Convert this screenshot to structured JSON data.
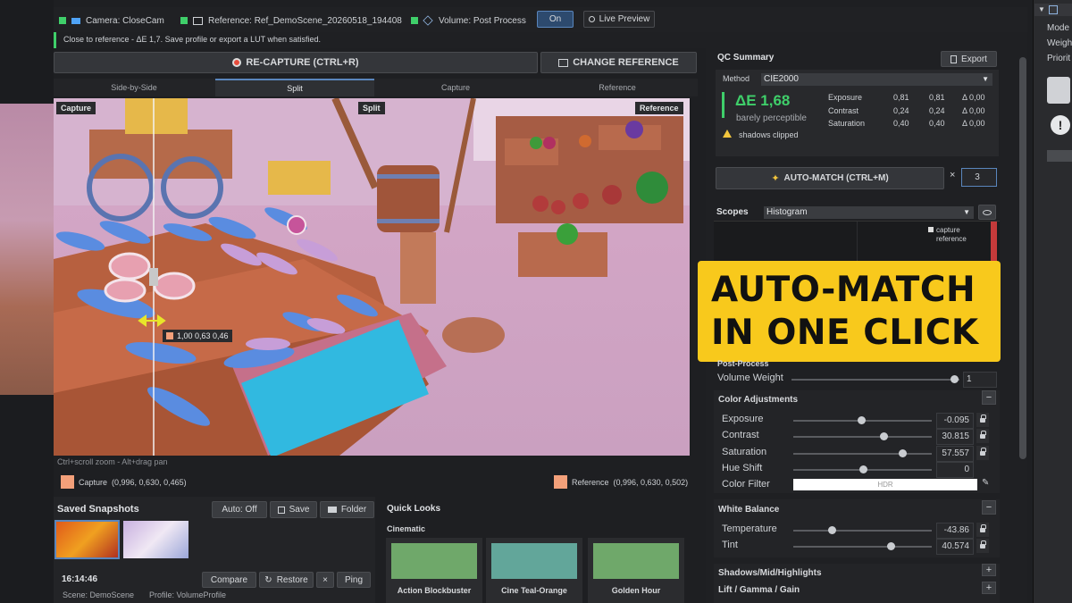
{
  "topbar": {
    "camera": "Camera: CloseCam",
    "reference": "Reference: Ref_DemoScene_20260518_194408",
    "volume": "Volume: Post Process",
    "on_label": "On",
    "live_preview": "Live Preview"
  },
  "status_message": "Close to reference - ΔE 1,7. Save profile or export a LUT when satisfied.",
  "actions": {
    "recapture": "RE-CAPTURE (CTRL+R)",
    "change_reference": "CHANGE REFERENCE"
  },
  "view_tabs": [
    {
      "label": "Side-by-Side"
    },
    {
      "label": "Split"
    },
    {
      "label": "Capture"
    },
    {
      "label": "Reference"
    }
  ],
  "viewport": {
    "capture_tag": "Capture",
    "split_tag": "Split",
    "reference_tag": "Reference",
    "probe_readout": "1,00 0,63 0,46",
    "hint": "Ctrl+scroll zoom - Alt+drag pan"
  },
  "samples": {
    "capture_label": "Capture",
    "capture_value": "(0,996, 0,630, 0,465)",
    "reference_label": "Reference",
    "reference_value": "(0,996, 0,630, 0,502)",
    "capture_color": "#f3a07a",
    "reference_color": "#f3a07a"
  },
  "snapshots": {
    "title": "Saved Snapshots",
    "auto": "Auto: Off",
    "save": "Save",
    "folder": "Folder",
    "time": "16:14:46",
    "compare": "Compare",
    "restore": "Restore",
    "x": "×",
    "ping": "Ping",
    "scene": "Scene: DemoScene",
    "profile": "Profile: VolumeProfile"
  },
  "quick_looks": {
    "title": "Quick Looks",
    "category": "Cinematic",
    "items": [
      {
        "name": "Action Blockbuster",
        "color": "#6fa86a"
      },
      {
        "name": "Cine Teal-Orange",
        "color": "#62a69a"
      },
      {
        "name": "Golden Hour",
        "color": "#6fa86a"
      }
    ]
  },
  "qc": {
    "title": "QC Summary",
    "export": "Export",
    "method_label": "Method",
    "method_value": "CIE2000",
    "delta": "ΔE 1,68",
    "delta_desc": "barely perceptible",
    "warning": "shadows clipped",
    "rows": [
      {
        "name": "Exposure",
        "a": "0,81",
        "b": "0,81",
        "d": "Δ 0,00"
      },
      {
        "name": "Contrast",
        "a": "0,24",
        "b": "0,24",
        "d": "Δ 0,00"
      },
      {
        "name": "Saturation",
        "a": "0,40",
        "b": "0,40",
        "d": "Δ 0,00"
      }
    ]
  },
  "automatch": {
    "label": "AUTO-MATCH (CTRL+M)",
    "x": "×",
    "count": "3"
  },
  "scopes": {
    "label": "Scopes",
    "mode": "Histogram",
    "legend_capture": "capture",
    "legend_reference": "reference"
  },
  "banner": {
    "line1": "AUTO-MATCH",
    "line2": "IN ONE CLICK"
  },
  "post_process": {
    "title": "Post-Process",
    "volume_weight_label": "Volume Weight",
    "volume_weight": "1",
    "volume_weight_fraction": 1.0
  },
  "color_adjustments": {
    "title": "Color Adjustments",
    "minus": "−",
    "params": [
      {
        "label": "Exposure",
        "value": "-0.095",
        "fraction": 0.49
      },
      {
        "label": "Contrast",
        "value": "30.815",
        "fraction": 0.65
      },
      {
        "label": "Saturation",
        "value": "57.557",
        "fraction": 0.79
      },
      {
        "label": "Hue Shift",
        "value": "0",
        "fraction": 0.5
      }
    ],
    "color_filter_label": "Color Filter",
    "color_filter_value": "HDR"
  },
  "white_balance": {
    "title": "White Balance",
    "minus": "−",
    "params": [
      {
        "label": "Temperature",
        "value": "-43.86",
        "fraction": 0.28
      },
      {
        "label": "Tint",
        "value": "40.574",
        "fraction": 0.7
      }
    ]
  },
  "shadows": {
    "title": "Shadows/Mid/Highlights",
    "plus": "+"
  },
  "lift": {
    "title": "Lift / Gamma / Gain",
    "plus": "+"
  },
  "inspector": {
    "items": [
      "Mode",
      "Weigh",
      "Priorit"
    ]
  }
}
